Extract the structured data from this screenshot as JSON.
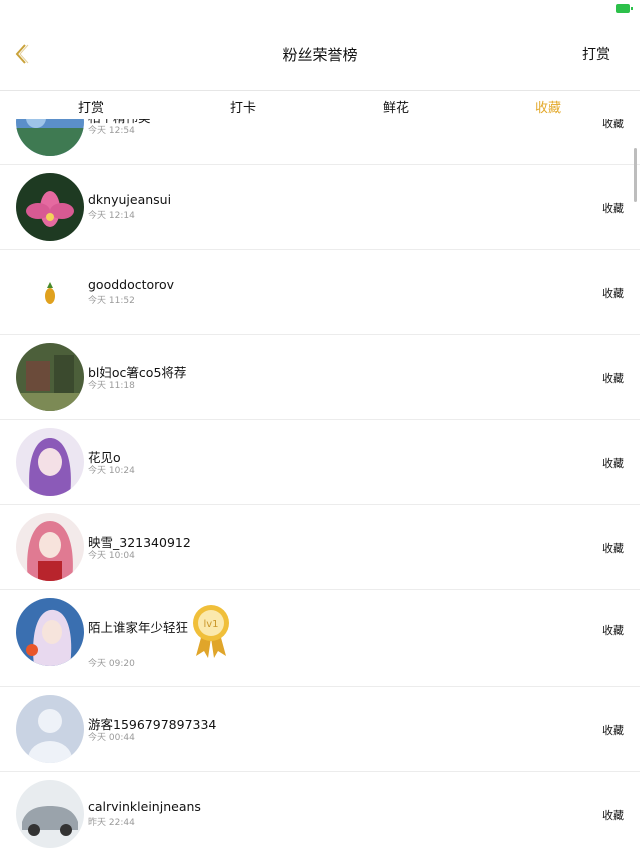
{
  "nav": {
    "title": "粉丝荣誉榜",
    "action_label": "打赏"
  },
  "tabs": [
    {
      "label": "打赏",
      "active": false
    },
    {
      "label": "打卡",
      "active": false
    },
    {
      "label": "鲜花",
      "active": false
    },
    {
      "label": "收藏",
      "active": true
    }
  ],
  "accent_color": "#e3a92c",
  "rows": [
    {
      "name": "相个精伟美",
      "time": "今天 12:54",
      "action": "收藏"
    },
    {
      "name": "dknyujeansui",
      "time": "今天 12:14",
      "action": "收藏"
    },
    {
      "name": "gooddoctorov",
      "time": "今天 11:52",
      "action": "收藏"
    },
    {
      "name": "bl妇oc箸co5将荐",
      "time": "今天 11:18",
      "action": "收藏"
    },
    {
      "name": "花见o",
      "time": "今天 10:24",
      "action": "收藏"
    },
    {
      "name": "映雪_321340912",
      "time": "今天 10:04",
      "action": "收藏"
    },
    {
      "name": "陌上谁家年少轻狂",
      "time": "今天 09:20",
      "action": "收藏",
      "medal": "lv1"
    },
    {
      "name": "游客1596797897334",
      "time": "今天 00:44",
      "action": "收藏"
    },
    {
      "name": "calrvinkleinjneans",
      "time": "昨天 22:44",
      "action": "收藏"
    }
  ]
}
